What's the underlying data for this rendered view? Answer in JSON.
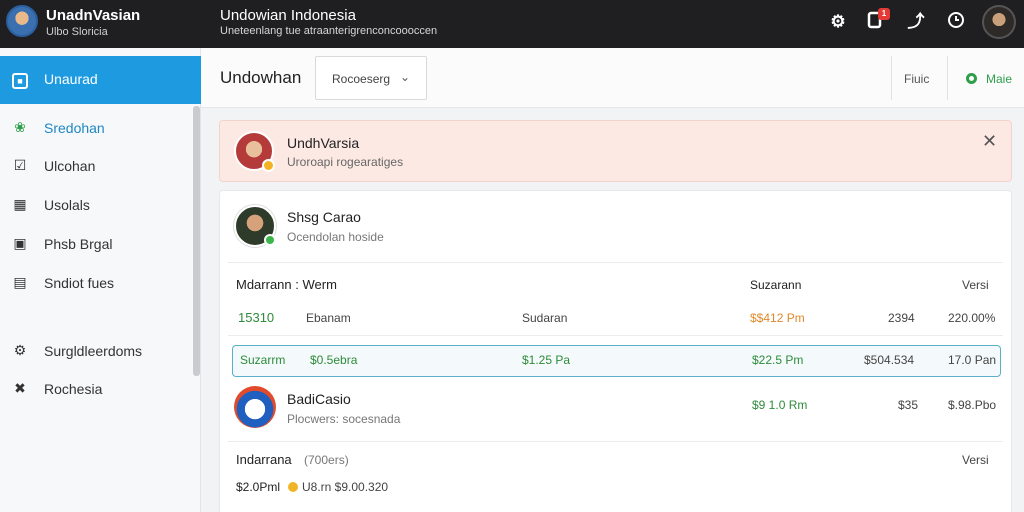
{
  "topbar": {
    "brand_name": "UnadnVasian",
    "brand_sub": "Ulbo Sloricia",
    "title": "Undowian Indonesia",
    "subtitle": "Uneteenlang tue atraanterigrenconcoooccen",
    "badge": "1"
  },
  "sidebar": {
    "active": {
      "label": "Unaurad",
      "icon": "square-icon"
    },
    "items": [
      {
        "label": "Sredohan",
        "icon": "leaf-icon"
      },
      {
        "label": "Ulcohan",
        "icon": "checkbox-icon"
      },
      {
        "label": "Usolals",
        "icon": "grid-icon"
      },
      {
        "label": "Phsb Brgal",
        "icon": "text-box-icon"
      },
      {
        "label": "Sndiot fues",
        "icon": "chart-box-icon"
      },
      {
        "label": "Surgldleerdoms",
        "icon": "gear-icon"
      },
      {
        "label": "Rochesia",
        "icon": "tools-icon"
      }
    ]
  },
  "header": {
    "title": "Undowhan",
    "dropdown_value": "Rocoeserg",
    "filter_label": "Fiuic",
    "more_label": "Maie"
  },
  "alert": {
    "title": "UndhVarsia",
    "subtitle": "Uroroapi rogearatiges"
  },
  "card": {
    "person_name": "Shsg Carao",
    "person_sub": "Ocendolan hoside",
    "section1": {
      "title": "Mdarrann : Werm",
      "col_a": "Suzarann",
      "col_b": "Versi"
    },
    "row1": {
      "c1": "15310",
      "c2": "Ebanam",
      "c3": "Sudaran",
      "c4": "$$412 Pm",
      "c5": "2394",
      "c6": "220.00%"
    },
    "row2": {
      "c1": "Suzarrm",
      "c2": "$0.5ebra",
      "c3": "$1.25 Pa",
      "c4": "$22.5 Pm",
      "c5": "$504.534",
      "c6": "17.0 Pan"
    },
    "item": {
      "name": "BadiCasio",
      "sub": "Plocwers: socesnada",
      "c4": "$9 1.0 Rm",
      "c5": "$35",
      "c6": "$.98.Pbo"
    },
    "section2": {
      "title": "Indarrana",
      "title_note": "(700ers)",
      "col_b": "Versi"
    },
    "row3": {
      "c1": "$2.0Pml",
      "c2": "U8.rn $9.00.320"
    }
  }
}
